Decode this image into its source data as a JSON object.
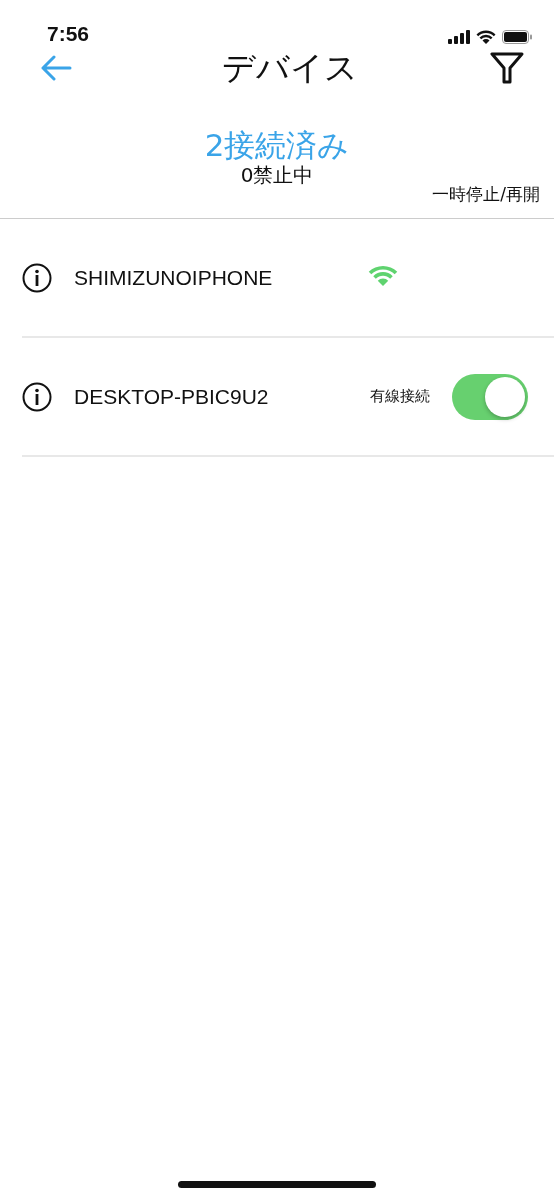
{
  "status_bar": {
    "time": "7:56"
  },
  "nav": {
    "title": "デバイス"
  },
  "summary": {
    "connected": "2接続済み",
    "blocked": "0禁止中",
    "pause_resume": "一時停止/再開"
  },
  "devices": [
    {
      "name": "SHIMIZUNOIPHONE",
      "kind": "wifi"
    },
    {
      "name": "DESKTOP-PBIC9U2",
      "kind": "wired",
      "label": "有線接続",
      "on": true
    }
  ]
}
